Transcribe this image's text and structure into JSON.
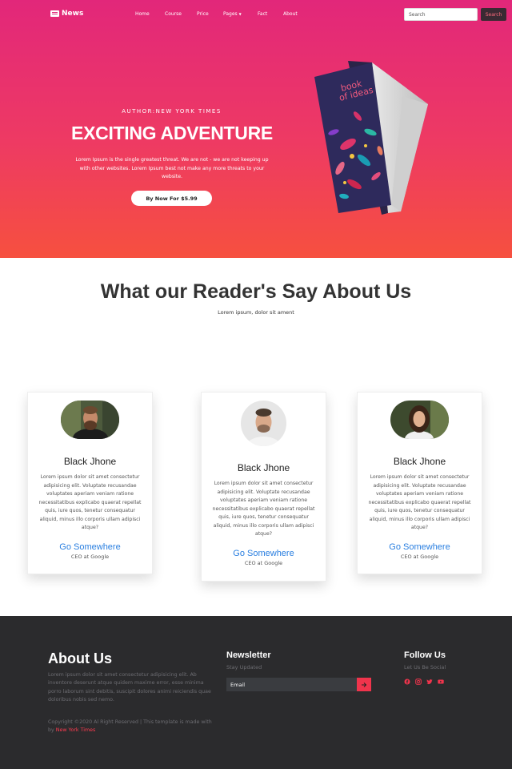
{
  "header": {
    "brand": "News",
    "nav": [
      "Home",
      "Course",
      "Price",
      "Pages",
      "Fact",
      "About"
    ],
    "search_placeholder": "Search",
    "search_button": "Search"
  },
  "hero": {
    "author": "AUTHOR:NEW YORK TIMES",
    "title": "EXCITING ADVENTURE",
    "description": "Lorem Ipsum is the single greatest threat. We are not - we are not keeping up with other websites. Lorem Ipsum best not make any more threats to your website.",
    "buy_button": "By Now For $5.99",
    "book_title_line1": "book",
    "book_title_line2": "of ideas"
  },
  "testimonials": {
    "title": "What our Reader's Say About Us",
    "subtitle": "Lorem ipsum, dolor sit ament",
    "cards": [
      {
        "name": "Black Jhone",
        "text": "Lorem ipsum dolor sit amet consectetur adipisicing elit. Voluptate recusandae voluptates aperiam veniam ratione necessitatibus explicabo quaerat repellat quis, iure quos, tenetur consequatur aliquid, minus illo corporis ullam adipisci atque?",
        "link": "Go Somewhere",
        "role": "CEO at Google"
      },
      {
        "name": "Black Jhone",
        "text": "Lorem ipsum dolor sit amet consectetur adipisicing elit. Voluptate recusandae voluptates aperiam veniam ratione necessitatibus explicabo quaerat repellat quis, iure quos, tenetur consequatur aliquid, minus illo corporis ullam adipisci atque?",
        "link": "Go Somewhere",
        "role": "CEO at Google"
      },
      {
        "name": "Black Jhone",
        "text": "Lorem ipsum dolor sit amet consectetur adipisicing elit. Voluptate recusandae voluptates aperiam veniam ratione necessitatibus explicabo quaerat repellat quis, iure quos, tenetur consequatur aliquid, minus illo corporis ullam adipisci atque?",
        "link": "Go Somewhere",
        "role": "CEO at Google"
      }
    ]
  },
  "footer": {
    "about_title": "About Us",
    "about_text": "Lorem ipsum dolor sit amet consectetur adipisicing elit. Ab inventore deserunt atque quidem maxime error, esse minima porro laborum sint debitis, suscipit dolores animi reiciendis quae doloribus nobis sed nemo.",
    "copyright": "Copyright ©2020 Al Right Reserved | This template is made with by",
    "copyright_link": "New York Times",
    "newsletter_title": "Newsletter",
    "newsletter_sub": "Stay Updated",
    "email_placeholder": "Email",
    "follow_title": "Follow Us",
    "follow_sub": "Let Us Be Social",
    "socials": [
      "facebook-icon",
      "instagram-icon",
      "twitter-icon",
      "youtube-icon"
    ]
  },
  "colors": {
    "hero_top": "#e2277a",
    "hero_bottom": "#f6503f",
    "link_blue": "#2a7fe0",
    "accent_red": "#f0344c",
    "footer_bg": "#2b2b2d"
  }
}
